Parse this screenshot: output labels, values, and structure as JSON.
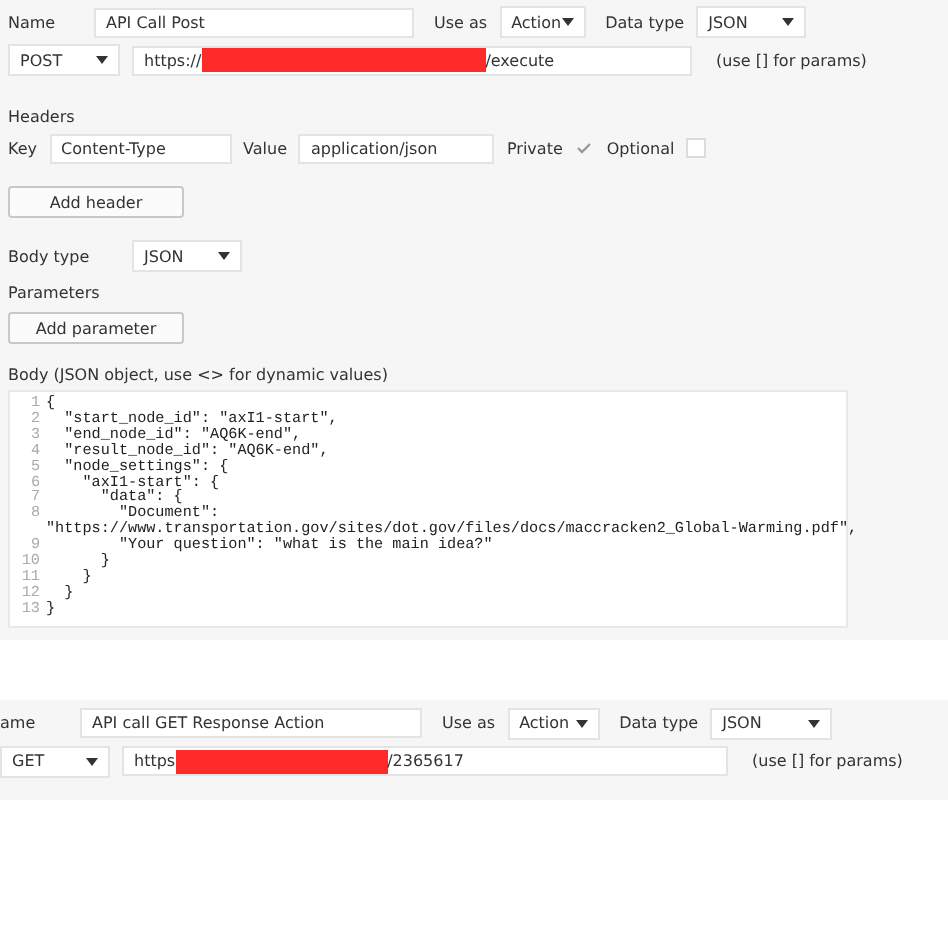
{
  "call_1": {
    "name_label": "Name",
    "name_value": "API Call Post",
    "use_as_label": "Use as",
    "use_as_value": "Action",
    "data_type_label": "Data type",
    "data_type_value": "JSON",
    "method": "POST",
    "url_prefix": "https://",
    "url_suffix": "/execute",
    "url_hint": "(use [] for params)",
    "headers_title": "Headers",
    "header": {
      "key_label": "Key",
      "key_value": "Content-Type",
      "value_label": "Value",
      "value_value": "application/json",
      "private_label": "Private",
      "private_checked": true,
      "optional_label": "Optional",
      "optional_checked": false
    },
    "add_header_button": "Add header",
    "body_type_label": "Body type",
    "body_type_value": "JSON",
    "parameters_title": "Parameters",
    "add_parameter_button": "Add parameter",
    "body_label": "Body (JSON object, use <> for dynamic values)",
    "body_lines": [
      {
        "number": "1",
        "text": "{"
      },
      {
        "number": "2",
        "text": "  \"start_node_id\": \"axI1-start\","
      },
      {
        "number": "3",
        "text": "  \"end_node_id\": \"AQ6K-end\","
      },
      {
        "number": "4",
        "text": "  \"result_node_id\": \"AQ6K-end\","
      },
      {
        "number": "5",
        "text": "  \"node_settings\": {"
      },
      {
        "number": "6",
        "text": "    \"axI1-start\": {"
      },
      {
        "number": "7",
        "text": "      \"data\": {"
      },
      {
        "number": "8",
        "text": "        \"Document\":"
      },
      {
        "text": "\"https://www.transportation.gov/sites/dot.gov/files/docs/maccracken2_Global-Warming.pdf\","
      },
      {
        "number": "9",
        "text": "        \"Your question\": \"what is the main idea?\""
      },
      {
        "number": "10",
        "text": "      }"
      },
      {
        "number": "11",
        "text": "    }"
      },
      {
        "number": "12",
        "text": "  }"
      },
      {
        "number": "13",
        "text": "}"
      }
    ]
  },
  "call_2": {
    "name_label": "ame",
    "name_value": "API call GET Response Action",
    "use_as_label": "Use as",
    "use_as_value": "Action",
    "data_type_label": "Data type",
    "data_type_value": "JSON",
    "method": "GET",
    "url_prefix": "https",
    "url_suffix": "/2365617",
    "url_hint": "(use [] for params)"
  }
}
